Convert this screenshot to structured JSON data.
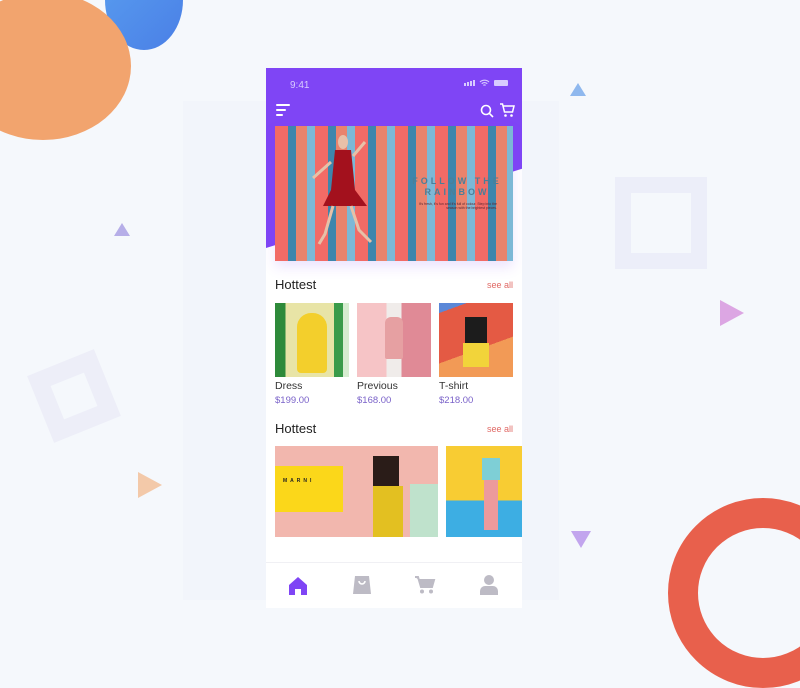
{
  "status_bar": {
    "time": "9:41"
  },
  "colors": {
    "accent": "#7f45f5",
    "price": "#7a62c9",
    "link": "#e06a66",
    "tab_inactive": "#bdbbc5"
  },
  "header": {
    "menu_icon": "menu-icon",
    "search_icon": "search-icon",
    "cart_icon": "cart-icon"
  },
  "banner": {
    "headline": "FOLLOW THE RAINBOW",
    "subtext": "It's fresh, it's fun and it's full of colour. Step into the season with the brightest pieces."
  },
  "sections": [
    {
      "title": "Hottest",
      "see_all": "see all",
      "products": [
        {
          "name": "Dress",
          "price": "$199.00"
        },
        {
          "name": "Previous",
          "price": "$168.00"
        },
        {
          "name": "T-shirt",
          "price": "$218.00"
        }
      ]
    },
    {
      "title": "Hottest",
      "see_all": "see all",
      "cards": [
        {
          "label": "MARNI"
        },
        {
          "label": ""
        }
      ]
    }
  ],
  "tabbar": [
    {
      "name": "home",
      "icon": "home-icon",
      "active": true
    },
    {
      "name": "bag",
      "icon": "bag-icon",
      "active": false
    },
    {
      "name": "cart",
      "icon": "cart-icon",
      "active": false
    },
    {
      "name": "profile",
      "icon": "user-icon",
      "active": false
    }
  ]
}
